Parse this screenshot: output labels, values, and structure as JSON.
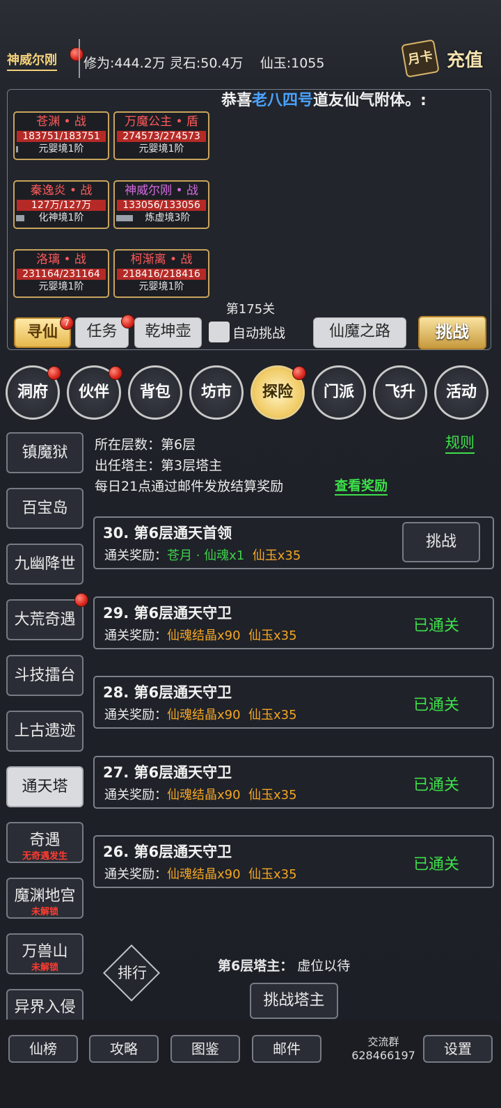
{
  "player": {
    "name": "神威尔刚",
    "stats": "修为:444.2万 灵石:50.4万    仙玉:1055"
  },
  "topbar": {
    "month_card": "月卡",
    "recharge": "充值"
  },
  "marquee": {
    "prefix": "恭喜",
    "highlight": "老八四号",
    "suffix": "道友仙气附体。:"
  },
  "team": [
    {
      "name": "苍渊 • 战",
      "hp": "183751/183751",
      "realm": "元婴境1阶",
      "color": "red"
    },
    {
      "name": "万魔公主 • 盾",
      "hp": "274573/274573",
      "realm": "元婴境1阶",
      "color": "red"
    },
    {
      "name": "秦逸炎 • 战",
      "hp": "127万/127万",
      "realm": "化神境1阶",
      "color": "red"
    },
    {
      "name": "神威尔刚 • 战",
      "hp": "133056/133056",
      "realm": "炼虚境3阶",
      "color": "purple"
    },
    {
      "name": "洛璃 • 战",
      "hp": "231164/231164",
      "realm": "元婴境1阶",
      "color": "red"
    },
    {
      "name": "柯渐离 • 战",
      "hp": "218416/218416",
      "realm": "元婴境1阶",
      "color": "red"
    }
  ],
  "stage": {
    "level": "第175关"
  },
  "action_bar": {
    "seek": "寻仙",
    "seek_badge": "7",
    "task": "任务",
    "pot": "乾坤壶",
    "auto": "自动挑战",
    "road": "仙魔之路",
    "challenge": "挑战"
  },
  "nav": [
    "洞府",
    "伙伴",
    "背包",
    "坊市",
    "探险",
    "门派",
    "飞升",
    "活动"
  ],
  "sidebar": [
    {
      "label": "镇魔狱",
      "sub": ""
    },
    {
      "label": "百宝岛",
      "sub": ""
    },
    {
      "label": "九幽降世",
      "sub": ""
    },
    {
      "label": "大荒奇遇",
      "sub": ""
    },
    {
      "label": "斗技擂台",
      "sub": ""
    },
    {
      "label": "上古遗迹",
      "sub": ""
    },
    {
      "label": "通天塔",
      "sub": ""
    },
    {
      "label": "奇遇",
      "sub": "无奇遇发生"
    },
    {
      "label": "魔渊地宫",
      "sub": "未解锁"
    },
    {
      "label": "万兽山",
      "sub": "未解锁"
    },
    {
      "label": "异界入侵",
      "sub": ""
    }
  ],
  "tower": {
    "floor_line": "所在层数：第6层",
    "master_line": "出任塔主：第3层塔主",
    "reward_line": "每日21点通过邮件发放结算奖励",
    "view_reward": "查看奖励",
    "rules": "规则",
    "reward_label": "通关奖励：",
    "items": [
      {
        "title": "30. 第6层通天首领",
        "reward1": "苍月 · 仙魂x1",
        "reward2": "仙玉x35",
        "status": "挑战"
      },
      {
        "title": "29. 第6层通天守卫",
        "reward1": "仙魂结晶x90",
        "reward2": "仙玉x35",
        "status": "已通关"
      },
      {
        "title": "28. 第6层通天守卫",
        "reward1": "仙魂结晶x90",
        "reward2": "仙玉x35",
        "status": "已通关"
      },
      {
        "title": "27. 第6层通天守卫",
        "reward1": "仙魂结晶x90",
        "reward2": "仙玉x35",
        "status": "已通关"
      },
      {
        "title": "26. 第6层通天守卫",
        "reward1": "仙魂结晶x90",
        "reward2": "仙玉x35",
        "status": "已通关"
      }
    ],
    "master_label": "第6层塔主：",
    "master_value": "虚位以待",
    "challenge_master": "挑战塔主",
    "rank": "排行"
  },
  "bottom": {
    "ranking": "仙榜",
    "guide": "攻略",
    "atlas": "图鉴",
    "mail": "邮件",
    "group_label": "交流群",
    "group_id": "628466197",
    "settings": "设置"
  }
}
